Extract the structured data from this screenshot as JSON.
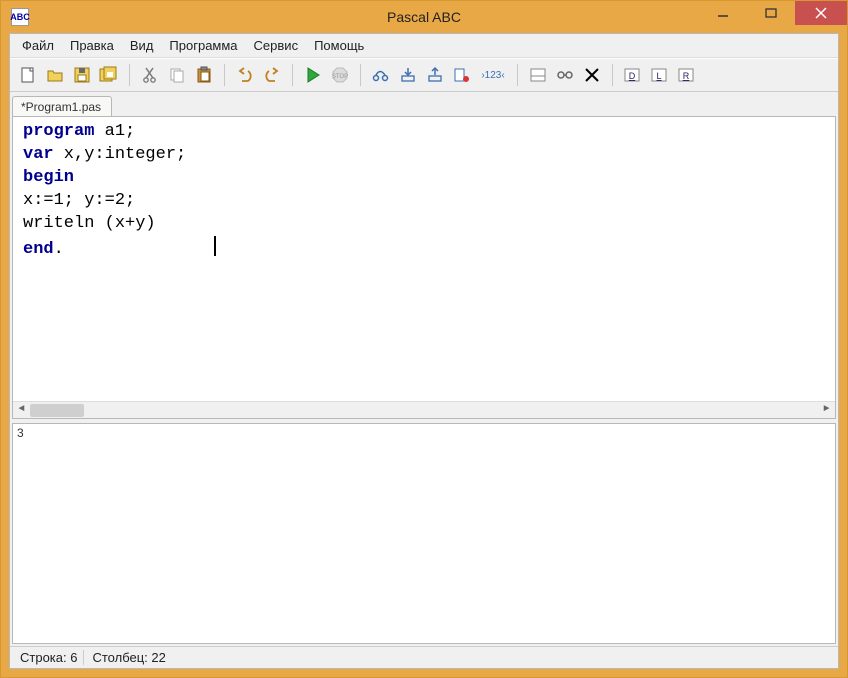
{
  "app": {
    "title": "Pascal ABC",
    "icon_text": "ABC"
  },
  "menu": {
    "file": "Файл",
    "edit": "Правка",
    "view": "Вид",
    "program": "Программа",
    "service": "Сервис",
    "help": "Помощь"
  },
  "tabs": [
    {
      "label": "*Program1.pas"
    }
  ],
  "code": {
    "line1_kw": "program",
    "line1_rest": " a1;",
    "line2_kw": "var",
    "line2_rest": " x,y:integer;",
    "line3_kw": "begin",
    "line3_rest": "",
    "line4": "x:=1; y:=2;",
    "line5": "writeln (x+y)",
    "line6_kw": "end",
    "line6_rest": "."
  },
  "output": "3",
  "status": {
    "line_label": "Строка: ",
    "line_value": "6",
    "col_label": "Столбец: ",
    "col_value": "22"
  },
  "toolbar_icons": {
    "new": "new-file-icon",
    "open": "open-file-icon",
    "save": "save-icon",
    "save_all": "save-all-icon",
    "cut": "cut-icon",
    "copy": "copy-icon",
    "paste": "paste-icon",
    "undo": "undo-icon",
    "redo": "redo-icon",
    "run": "run-icon",
    "stop": "stop-icon",
    "step_over": "step-over-icon",
    "step_into": "step-into-icon",
    "step_out": "step-out-icon",
    "breakpoint": "breakpoint-icon",
    "watch_123": "watch-expr-icon",
    "panel": "panel-icon",
    "watch": "watch-icon",
    "close_panel": "close-panel-icon",
    "syntax_d": "syntax-check-icon",
    "syntax_l": "list-errors-icon",
    "syntax_r": "find-replace-icon"
  }
}
